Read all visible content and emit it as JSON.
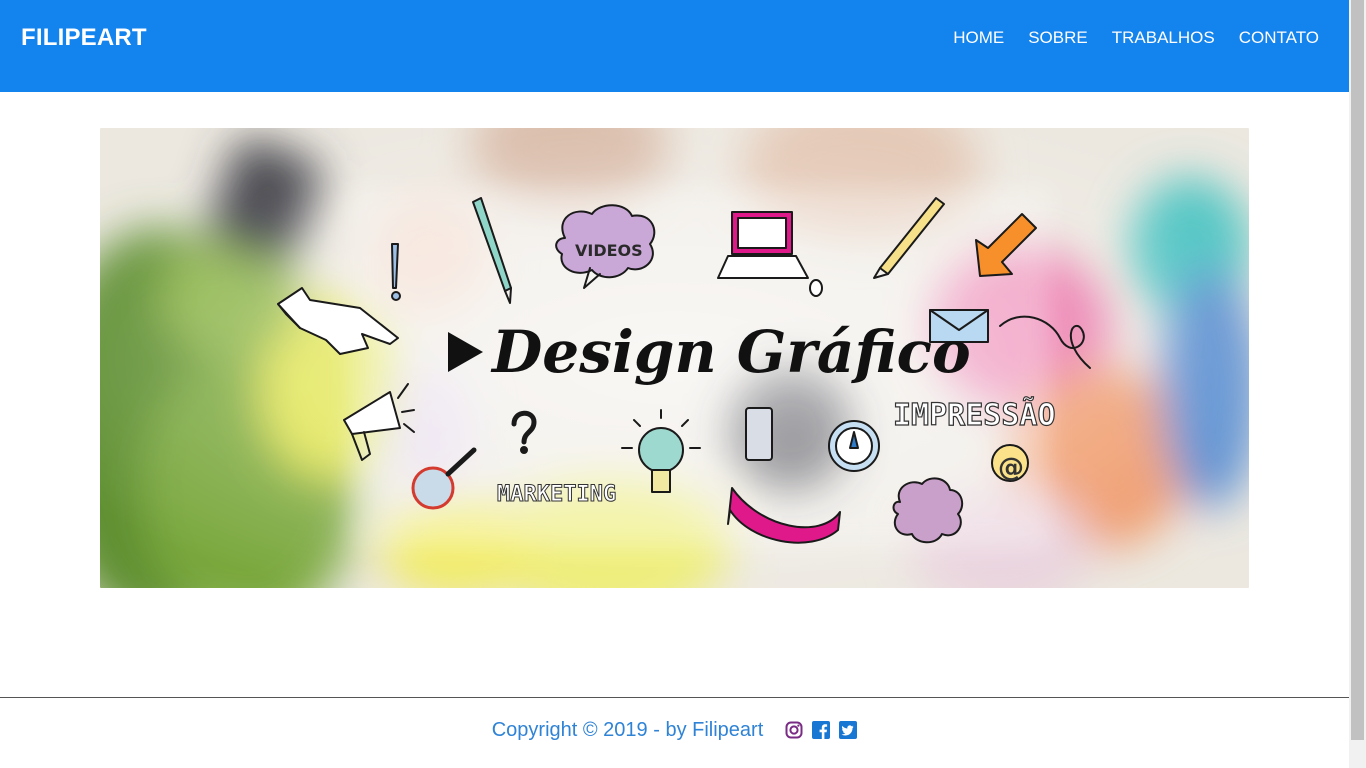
{
  "header": {
    "brand": "FILIPEART",
    "nav": [
      {
        "label": "HOME"
      },
      {
        "label": "SOBRE"
      },
      {
        "label": "TRABALHOS"
      },
      {
        "label": "CONTATO"
      }
    ]
  },
  "banner": {
    "title": "Design Gráfico",
    "labels": {
      "videos": "VIDEOS",
      "impressao": "IMPRESSÃO",
      "marketing": "MARKETING",
      "at_sign": "@",
      "question": "?",
      "exclamation": "!"
    }
  },
  "footer": {
    "copyright": "Copyright © 2019 - by Filipeart",
    "social_icons": [
      "instagram-icon",
      "facebook-icon",
      "twitter-icon"
    ]
  },
  "colors": {
    "header_bg": "#1383ee",
    "footer_text": "#2f83d6",
    "social_instagram": "#7a2c84",
    "social_blue": "#1877d2"
  }
}
